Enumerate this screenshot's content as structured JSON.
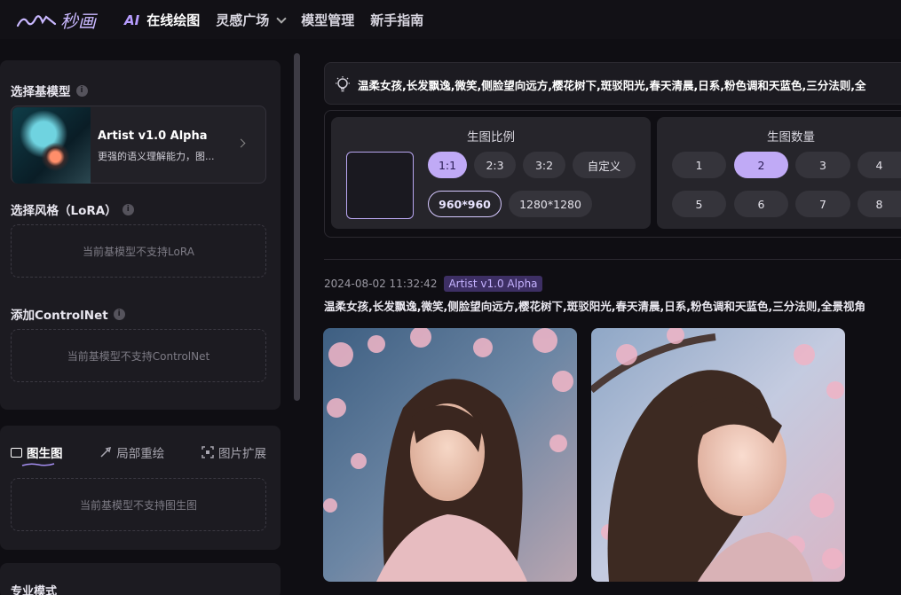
{
  "header": {
    "logo_text": "秒画",
    "nav": [
      {
        "prefix": "AI",
        "label": "在线绘图"
      },
      {
        "label": "灵感广场"
      },
      {
        "label": "模型管理"
      },
      {
        "label": "新手指南"
      }
    ]
  },
  "sidebar": {
    "base_model": {
      "title": "选择基模型",
      "name": "Artist v1.0 Alpha",
      "desc": "更强的语义理解能力，图..."
    },
    "lora": {
      "title": "选择风格（LoRA）",
      "empty": "当前基模型不支持LoRA"
    },
    "controlnet": {
      "title": "添加ControlNet",
      "empty": "当前基模型不支持ControlNet"
    },
    "tabs": [
      "图生图",
      "局部重绘",
      "图片扩展"
    ],
    "img2img_empty": "当前基模型不支持图生图",
    "pro_mode": "专业模式"
  },
  "prompt": {
    "text": "温柔女孩,长发飘逸,微笑,侧脸望向远方,樱花树下,斑驳阳光,春天清晨,日系,粉色调和天蓝色,三分法则,全"
  },
  "settings": {
    "ratio_title": "生图比例",
    "ratios": [
      "1:1",
      "2:3",
      "3:2",
      "自定义"
    ],
    "sizes": [
      "960*960",
      "1280*1280"
    ],
    "count_title": "生图数量",
    "counts": [
      "1",
      "2",
      "3",
      "4",
      "5",
      "6",
      "7",
      "8"
    ]
  },
  "result": {
    "time": "2024-08-02 11:32:42",
    "model_badge": "Artist v1.0 Alpha",
    "prompt": "温柔女孩,长发飘逸,微笑,侧脸望向远方,樱花树下,斑驳阳光,春天清晨,日系,粉色调和天蓝色,三分法则,全景视角"
  },
  "colors": {
    "accent": "#c0aaf6",
    "background": "#0f0e13",
    "panel": "#1c1b21"
  }
}
